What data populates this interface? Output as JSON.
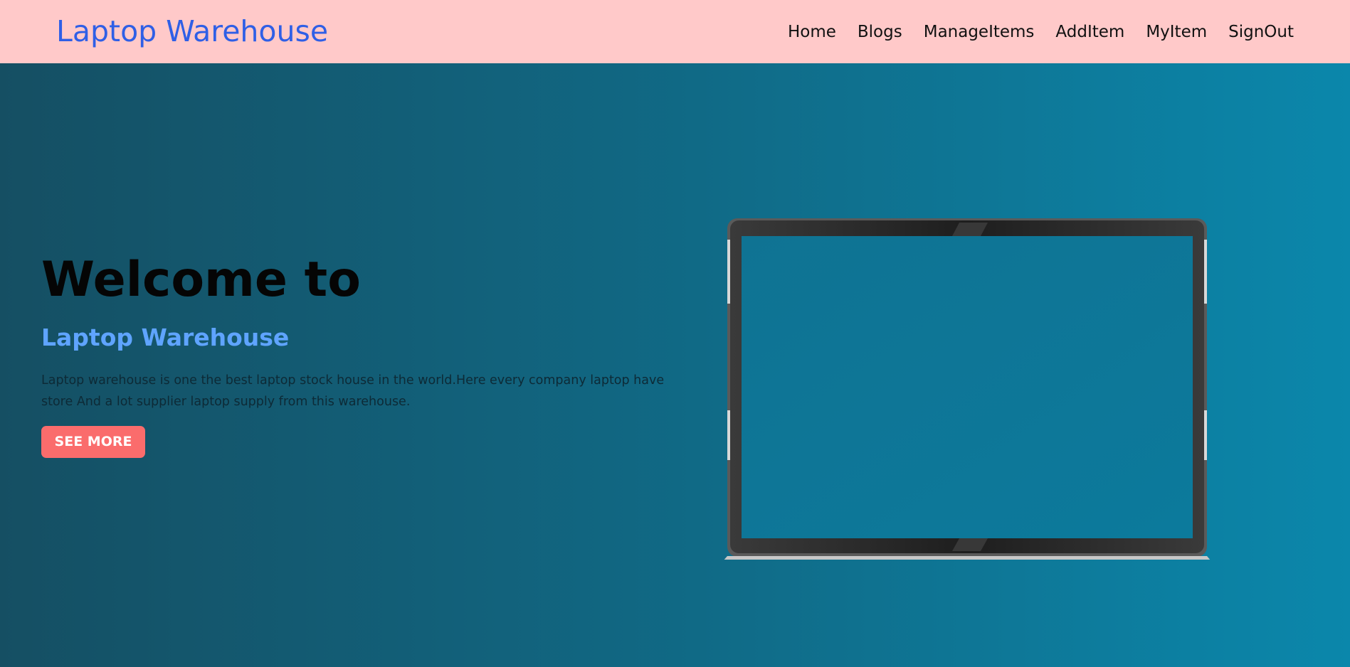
{
  "navbar": {
    "brand": "Laptop Warehouse",
    "links": [
      "Home",
      "Blogs",
      "ManageItems",
      "AddItem",
      "MyItem",
      "SignOut"
    ]
  },
  "hero": {
    "title": "Welcome to",
    "subtitle": "Laptop Warehouse",
    "description": "Laptop warehouse is one the best laptop stock house in the world.Here every company laptop have store And a lot supplier laptop supply from this warehouse.",
    "button_label": "SEE MORE"
  },
  "colors": {
    "navbar_bg": "#ffc9c9",
    "brand": "#2f5fe6",
    "hero_gradient_start": "#154f63",
    "hero_gradient_end": "#0b87ab",
    "subtitle": "#5fa4ff",
    "button_bg": "#fa6c6c"
  },
  "icons": {
    "hero_image": "laptop-illustration"
  }
}
